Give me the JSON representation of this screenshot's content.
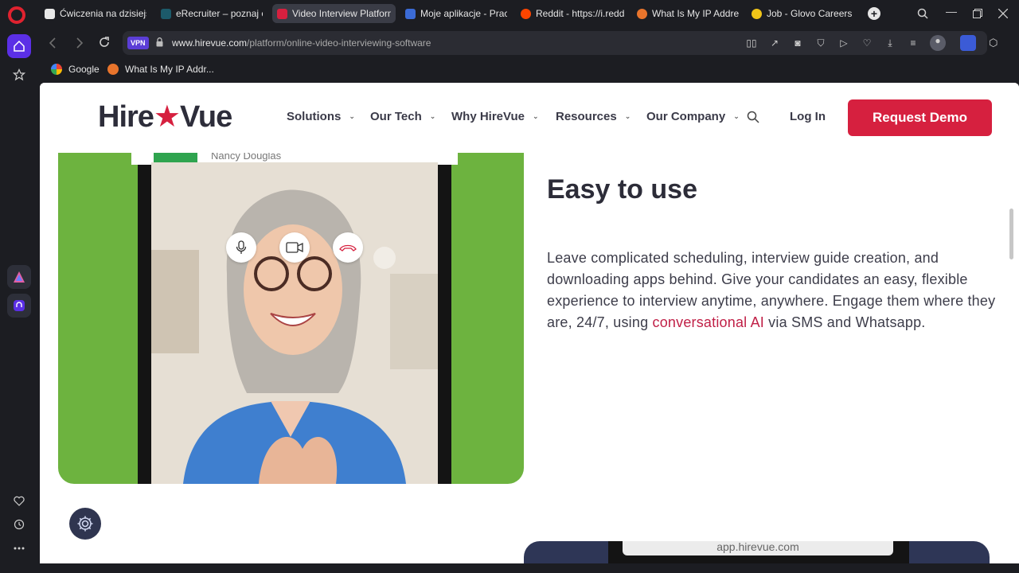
{
  "browser": {
    "tabs": [
      {
        "title": "Ćwiczenia na dzisiejszy",
        "color": "#e8e8e8"
      },
      {
        "title": "eRecruiter – poznaj cen",
        "color": "#1c5a6a"
      },
      {
        "title": "Video Interview Platform |",
        "color": "#d6203f",
        "active": true
      },
      {
        "title": "Moje aplikacje - Pracuj.",
        "color": "#3b6bd6"
      },
      {
        "title": "Reddit - https://i.redd.i",
        "color": "#ff4500"
      },
      {
        "title": "What Is My IP Address",
        "color": "#e8742c"
      },
      {
        "title": "Job - Glovo Careers",
        "color": "#f0c418"
      }
    ],
    "vpn_label": "VPN",
    "url_domain": "www.hirevue.com",
    "url_path": "/platform/online-video-interviewing-software",
    "bookmarks": [
      {
        "label": "Google",
        "color": "#4285f4"
      },
      {
        "label": "What Is My IP Addr...",
        "color": "#e8742c"
      }
    ]
  },
  "site": {
    "logo_left": "Hire",
    "logo_right": "Vue",
    "nav": [
      "Solutions",
      "Our Tech",
      "Why HireVue",
      "Resources",
      "Our Company"
    ],
    "login": "Log In",
    "cta": "Request Demo",
    "caller_name": "Nancy Douglas",
    "section_title": "Easy to use",
    "para_before": "Leave complicated scheduling, interview guide creation, and downloading apps behind. Give your candidates an easy, flexible experience to interview anytime, anywhere. Engage them where they are, 24/7, using ",
    "para_link": "conversational AI",
    "para_after": " via SMS and Whatsapp.",
    "app_url": "app.hirevue.com"
  },
  "colors": {
    "brand_red": "#d6203f",
    "green": "#6db33f",
    "navy": "#2e3656"
  }
}
